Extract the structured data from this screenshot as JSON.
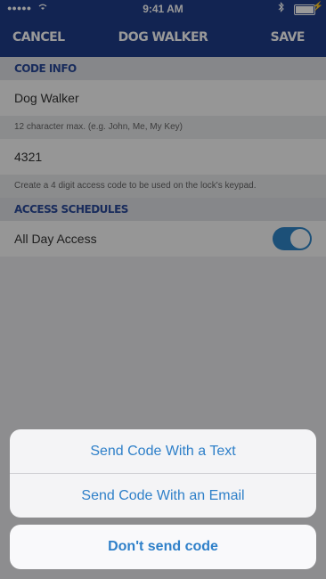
{
  "status_bar": {
    "signal": "●●●●●",
    "wifi_icon": "wifi-icon",
    "time": "9:41 AM",
    "bluetooth_icon": "bluetooth-icon",
    "battery_icon": "battery-icon"
  },
  "navbar": {
    "cancel_label": "CANCEL",
    "title": "DOG WALKER",
    "save_label": "SAVE",
    "color": "#1f3d89"
  },
  "code_info": {
    "header": "CODE INFO",
    "name_value": "Dog Walker",
    "name_hint": "12 character max. (e.g. John, Me, My Key)",
    "code_value": "4321",
    "code_hint": "Create a 4 digit access code to be used on the lock's keypad."
  },
  "access_schedules": {
    "header": "ACCESS SCHEDULES",
    "all_day_label": "All Day Access",
    "all_day_enabled": true
  },
  "action_sheet": {
    "options": [
      {
        "label": "Send Code With a Text"
      },
      {
        "label": "Send Code With an Email"
      }
    ],
    "cancel_label": "Don't send code",
    "accent": "#2f80c9"
  }
}
